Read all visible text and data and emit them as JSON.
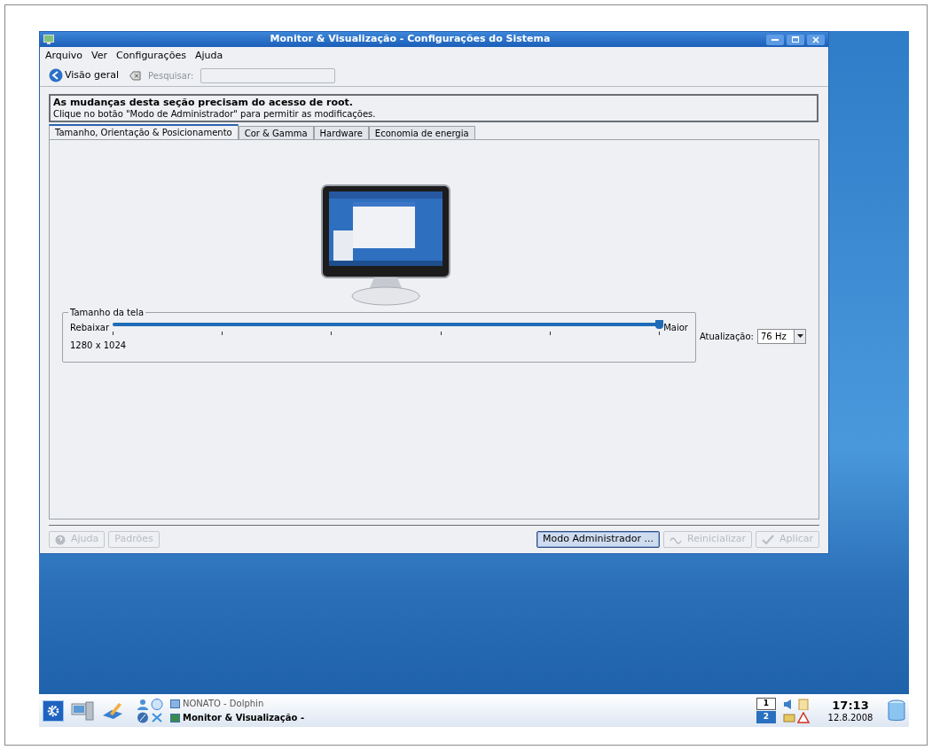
{
  "window": {
    "title": "Monitor & Visualização - Configurações do Sistema"
  },
  "menu": [
    "Arquivo",
    "Ver",
    "Configurações",
    "Ajuda"
  ],
  "toolbar": {
    "overview": "Visão geral",
    "search_label": "Pesquisar:",
    "search_disabled": true
  },
  "notice": {
    "heading": "As mudanças desta seção precisam do acesso de root.",
    "text": "Clique no botão \"Modo de Administrador\" para permitir as modificações."
  },
  "tabs": [
    {
      "label": "Tamanho, Orientação & Posicionamento",
      "selected": true
    },
    {
      "label": "Cor & Gamma",
      "selected": false
    },
    {
      "label": "Hardware",
      "selected": false
    },
    {
      "label": "Economia de energia",
      "selected": false
    }
  ],
  "screen_size": {
    "group": "Tamanho da tela",
    "min_label": "Rebaixar",
    "max_label": "Maior",
    "level": 1,
    "resolution": "1280 x 1024"
  },
  "refresh": {
    "label": "Atualização:",
    "value": "76 Hz"
  },
  "buttons_left": [
    {
      "label": "Ajuda",
      "kind": "help",
      "disabled": true
    },
    {
      "label": "Padrões",
      "kind": "plain",
      "disabled": true
    }
  ],
  "buttons_right": [
    {
      "label": "Modo Administrador ...",
      "kind": "plain",
      "disabled": false
    },
    {
      "label": "Reinicializar",
      "kind": "reset",
      "disabled": true
    },
    {
      "label": "Aplicar",
      "kind": "apply",
      "disabled": true
    }
  ],
  "taskbar": {
    "tasks": [
      {
        "label": "NONATO - Dolphin",
        "selected": false
      },
      {
        "label": "Monitor & Visualização -",
        "selected": true
      }
    ],
    "pager": [
      {
        "label": "1",
        "selected": false
      },
      {
        "label": "2",
        "selected": true
      }
    ],
    "clock": {
      "time": "17:13",
      "date": "12.8.2008"
    }
  }
}
